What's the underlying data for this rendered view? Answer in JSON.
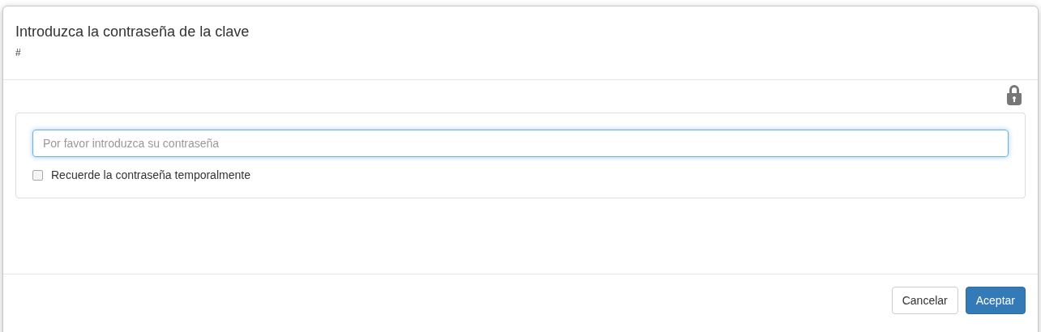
{
  "dialog": {
    "title": "Introduzca la contraseña de la clave",
    "subtitle": "#"
  },
  "password_field": {
    "placeholder": "Por favor introduzca su contraseña",
    "focused": true
  },
  "remember_checkbox": {
    "label": "Recuerde la contraseña temporalmente",
    "checked": false
  },
  "buttons": [
    {
      "label": "Cancelar",
      "kind": "default"
    },
    {
      "label": "Aceptar",
      "kind": "primary"
    }
  ]
}
